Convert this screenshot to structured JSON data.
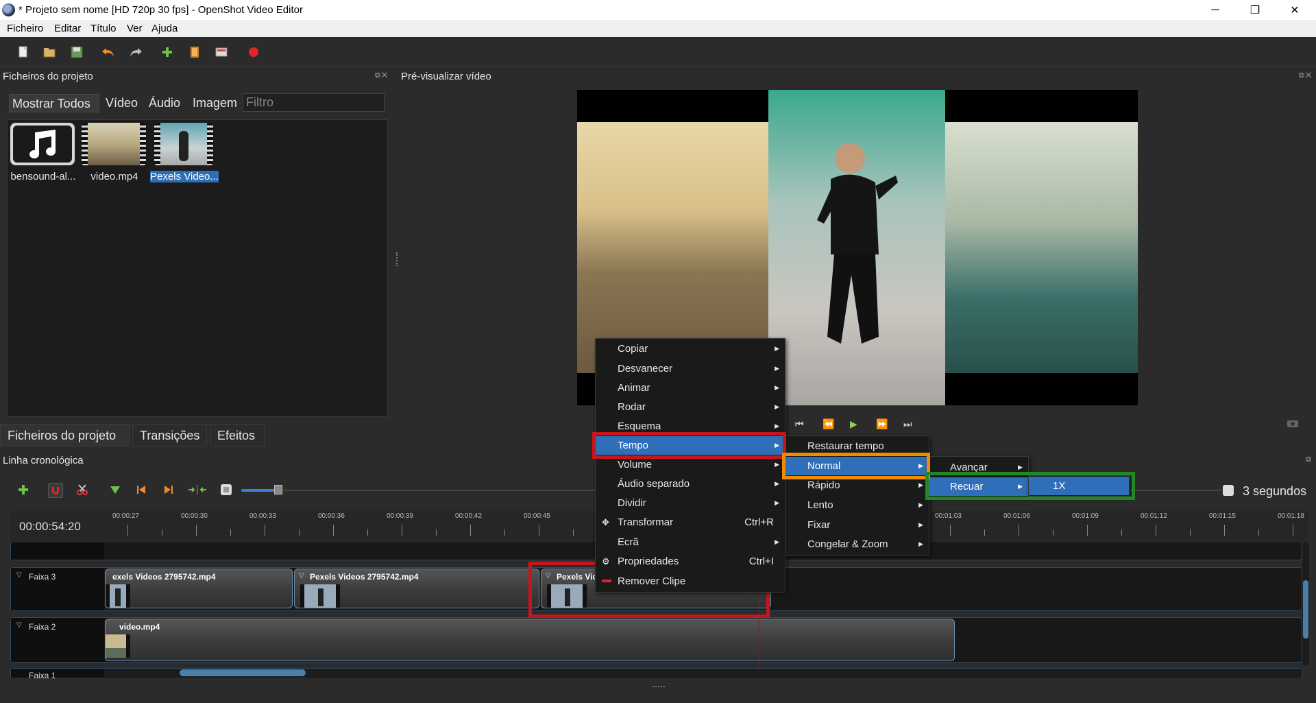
{
  "window": {
    "title": "* Projeto sem nome [HD 720p 30 fps] - OpenShot Video Editor",
    "minimize": "─",
    "restore": "❐",
    "close": "✕"
  },
  "menubar": {
    "items": [
      "Ficheiro",
      "Editar",
      "Título",
      "Ver",
      "Ajuda"
    ]
  },
  "project_files": {
    "title": "Ficheiros do projeto",
    "filter_tabs": [
      "Mostrar Todos",
      "Vídeo",
      "Áudio",
      "Imagem"
    ],
    "filter_placeholder": "Filtro",
    "files": [
      {
        "name": "bensound-al...",
        "icon": "music-note-icon"
      },
      {
        "name": "video.mp4",
        "icon": "video-thumbnail"
      },
      {
        "name": "Pexels Video...",
        "icon": "video-thumbnail"
      }
    ]
  },
  "bottom_tabs": [
    "Ficheiros do projeto",
    "Transições",
    "Efeitos"
  ],
  "preview": {
    "title": "Pré-visualizar vídeo"
  },
  "timeline": {
    "title": "Linha cronológica",
    "timecode": "00:00:54:20",
    "zoom_label": "3 segundos",
    "ticks": [
      "00:00:27",
      "00:00:30",
      "00:00:33",
      "00:00:36",
      "00:00:39",
      "00:00:42",
      "00:00:45",
      "00:01:03",
      "00:01:06",
      "00:01:09",
      "00:01:12",
      "00:01:15",
      "00:01:18"
    ],
    "tracks": [
      {
        "name": "Faixa 3"
      },
      {
        "name": "Faixa 2"
      },
      {
        "name": "Faixa 1"
      }
    ],
    "clips": {
      "t3_a": "exels Videos 2795742.mp4",
      "t3_b": "Pexels Videos 2795742.mp4",
      "t3_c": "Pexels Vide",
      "t2_a": "video.mp4"
    }
  },
  "context_menu": {
    "items": [
      {
        "label": "Copiar",
        "submenu": true
      },
      {
        "label": "Desvanecer",
        "submenu": true
      },
      {
        "label": "Animar",
        "submenu": true
      },
      {
        "label": "Rodar",
        "submenu": true
      },
      {
        "label": "Esquema",
        "submenu": true
      },
      {
        "label": "Tempo",
        "submenu": true
      },
      {
        "label": "Volume",
        "submenu": true
      },
      {
        "label": "Áudio separado",
        "submenu": true
      },
      {
        "label": "Dividir",
        "submenu": true
      },
      {
        "label": "Transformar",
        "shortcut": "Ctrl+R"
      },
      {
        "label": "Ecrã",
        "submenu": true
      },
      {
        "label": "Propriedades",
        "shortcut": "Ctrl+I"
      },
      {
        "label": "Remover Clipe"
      }
    ]
  },
  "tempo_menu": {
    "items": [
      "Restaurar tempo",
      "Normal",
      "Rápido",
      "Lento",
      "Fixar",
      "Congelar & Zoom"
    ]
  },
  "normal_menu": {
    "items": [
      "Avançar",
      "Recuar"
    ]
  },
  "recuar_menu": {
    "items": [
      "1X"
    ]
  },
  "colors": {
    "highlight_red": "#c8151b",
    "highlight_orange": "#f08c00",
    "highlight_green": "#1f8a25",
    "menu_selected": "#2f6eb8"
  }
}
